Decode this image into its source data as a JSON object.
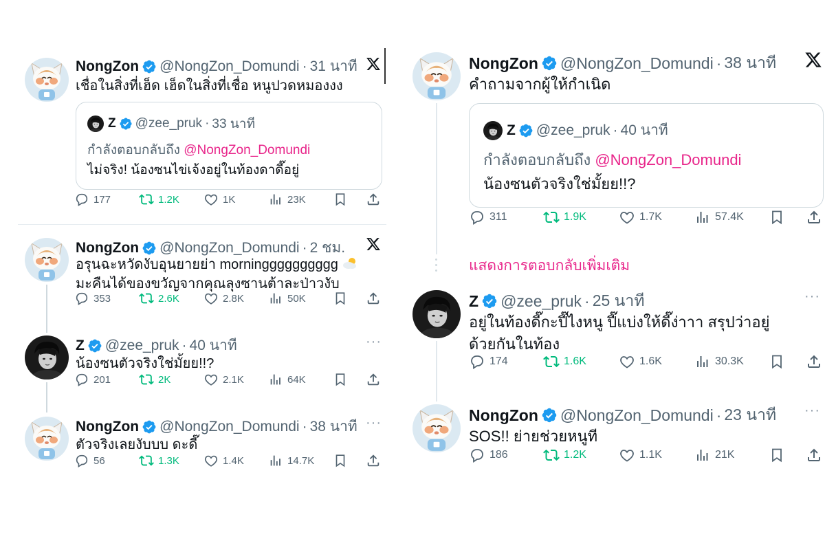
{
  "brand": {
    "accent": "#1d9bf0",
    "mention_color": "#e8258a",
    "retweet_color": "#00ba7c"
  },
  "left": {
    "tweet1": {
      "name": "NongZon",
      "handle": "@NongZon_Domundi",
      "time": "31 นาที",
      "text": "เชื่อในสิ่งที่เฮ็ด เฮ็ดในสิ่งที่เชื่อ หนูปวดหมองงง",
      "quote": {
        "name": "Z",
        "handle": "@zee_pruk",
        "time": "33 นาที",
        "reply_label": "กำลังตอบกลับถึง",
        "reply_mention": "@NongZon_Domundi",
        "text": "ไม่จริง! น้องซนไข่เจ้งอยู่ในท้องดาดี๊อยู่"
      },
      "stats": {
        "replies": "177",
        "reposts": "1.2K",
        "likes": "1K",
        "views": "23K"
      }
    },
    "tweet2": {
      "name": "NongZon",
      "handle": "@NongZon_Domundi",
      "time": "2 ชม.",
      "text_line1": "อรุนฉะหวัดงับอุนยายย่า morningggggggggg",
      "text_line2": "มะคืนได้ของขวัญจากคุณลุงซานต้าละป่าวงับ",
      "stats": {
        "replies": "353",
        "reposts": "2.6K",
        "likes": "2.8K",
        "views": "50K"
      }
    },
    "tweet3": {
      "name": "Z",
      "handle": "@zee_pruk",
      "time": "40 นาที",
      "text": "น้องซนตัวจริงใช่มั้ยย!!?",
      "stats": {
        "replies": "201",
        "reposts": "2K",
        "likes": "2.1K",
        "views": "64K"
      }
    },
    "tweet4": {
      "name": "NongZon",
      "handle": "@NongZon_Domundi",
      "time": "38 นาที",
      "text": "ตัวจริงเลยงับบบ ดะดี๊",
      "stats": {
        "replies": "56",
        "reposts": "1.3K",
        "likes": "1.4K",
        "views": "14.7K"
      }
    }
  },
  "right": {
    "tweet1": {
      "name": "NongZon",
      "handle": "@NongZon_Domundi",
      "time": "38 นาที",
      "text": "คำถามจากผู้ให้กำเนิด",
      "quote": {
        "name": "Z",
        "handle": "@zee_pruk",
        "time": "40 นาที",
        "reply_label": "กำลังตอบกลับถึง",
        "reply_mention": "@NongZon_Domundi",
        "text": "น้องซนตัวจริงใช่มั้ยย!!?"
      },
      "stats": {
        "replies": "311",
        "reposts": "1.9K",
        "likes": "1.7K",
        "views": "57.4K"
      }
    },
    "show_more": "แสดงการตอบกลับเพิ่มเติม",
    "tweet2": {
      "name": "Z",
      "handle": "@zee_pruk",
      "time": "25 นาที",
      "text_line1": "อยู่ในท้องดี๊กะปี๊ไงหนู ปี๊แบ่งให้ดี๊ง่าาา สรุปว่าอยู่",
      "text_line2": "ด้วยกันในท้อง",
      "stats": {
        "replies": "174",
        "reposts": "1.6K",
        "likes": "1.6K",
        "views": "30.3K"
      }
    },
    "tweet3": {
      "name": "NongZon",
      "handle": "@NongZon_Domundi",
      "time": "23 นาที",
      "text": "SOS!! ย่ายช่วยหนูที",
      "stats": {
        "replies": "186",
        "reposts": "1.2K",
        "likes": "1.1K",
        "views": "21K"
      }
    }
  },
  "icons": {
    "verified": "verified-badge-icon",
    "x_logo": "x-logo-icon",
    "more": "more-icon",
    "reply": "reply-icon",
    "repost": "repost-icon",
    "like": "like-icon",
    "views": "views-icon",
    "bookmark": "bookmark-icon",
    "share": "share-icon",
    "weather": "sun-behind-cloud-icon"
  },
  "more_glyph": "···"
}
